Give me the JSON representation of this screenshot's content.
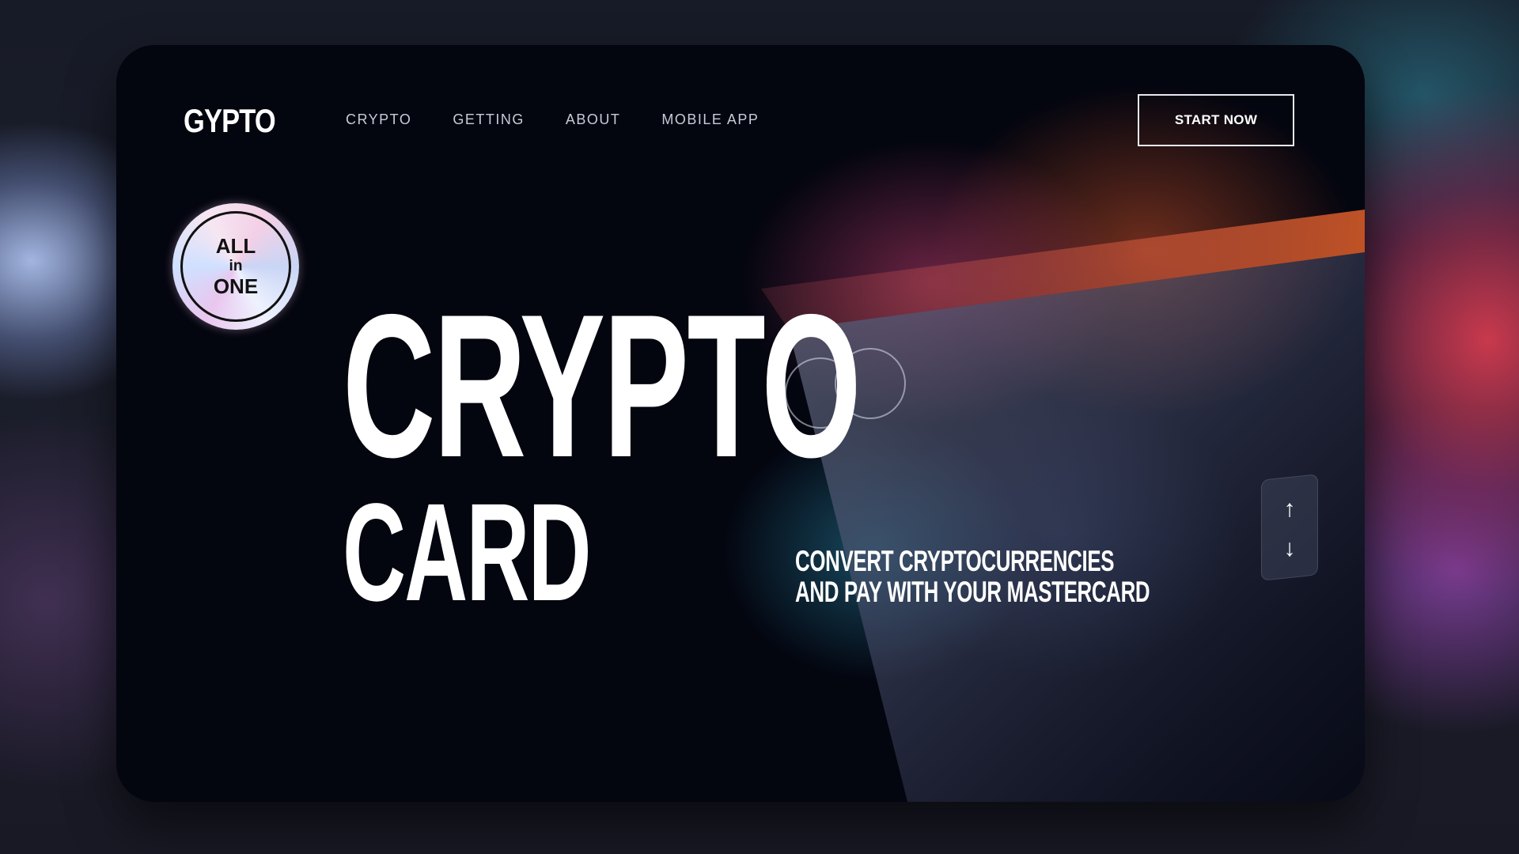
{
  "brand": {
    "logo_text": "GYPTO"
  },
  "nav": {
    "items": [
      {
        "label": "CRYPTO"
      },
      {
        "label": "GETTING"
      },
      {
        "label": "ABOUT"
      },
      {
        "label": "MOBILE APP"
      }
    ]
  },
  "header": {
    "cta_label": "START NOW"
  },
  "badge": {
    "line1": "ALL",
    "line2": "in",
    "line3": "ONE"
  },
  "hero": {
    "title": "CRYPTO",
    "subtitle": "CARD",
    "tagline_line1": "CONVERT CRYPTOCURRENCIES",
    "tagline_line2": "AND PAY WITH YOUR MASTERCARD"
  },
  "scroll_controls": {
    "up_icon": "arrow-up-icon",
    "down_icon": "arrow-down-icon"
  },
  "colors": {
    "background": "#03050f",
    "text": "#ffffff",
    "nav_text": "#c8cbd8",
    "accent_orange": "#c8502a",
    "accent_teal": "#2a8aa0",
    "accent_magenta": "#b83c70"
  }
}
